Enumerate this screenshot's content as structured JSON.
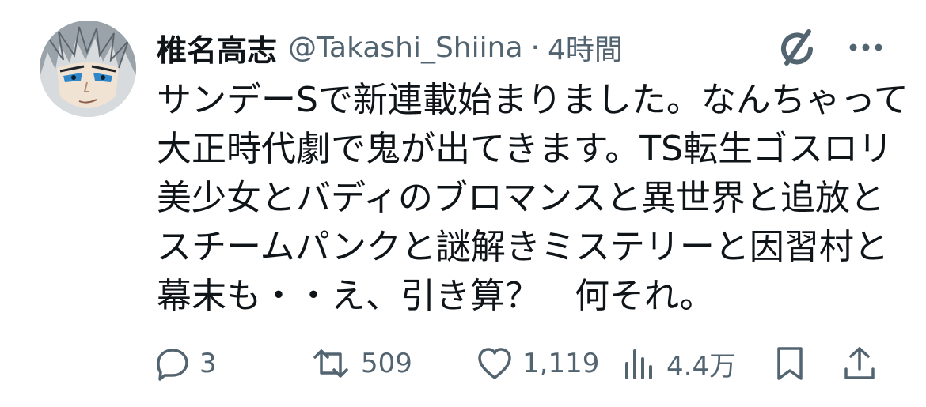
{
  "tweet": {
    "author": {
      "display_name": "椎名高志",
      "handle": "@Takashi_Shiina",
      "avatar_icon": "avatar-image"
    },
    "separator": "·",
    "timestamp": "4時間",
    "text_lines": [
      "サンデーSで新連載始まりました。なんちゃって",
      "大正時代劇で鬼が出てきます。TS転生ゴスロリ",
      "美少女とバディのブロマンスと異世界と追放と",
      "スチームパンクと謎解きミステリーと因習村と",
      "幕末も・・え、引き算？　何それ。"
    ],
    "header_icons": {
      "grok": "grok-icon",
      "more": "more-icon"
    },
    "actions": {
      "reply": {
        "icon": "reply-icon",
        "count": "3"
      },
      "repost": {
        "icon": "repost-icon",
        "count": "509"
      },
      "like": {
        "icon": "heart-icon",
        "count": "1,119"
      },
      "views": {
        "icon": "views-icon",
        "count": "4.4万"
      },
      "bookmark": {
        "icon": "bookmark-icon"
      },
      "share": {
        "icon": "share-icon"
      }
    },
    "colors": {
      "text_primary": "#0f1419",
      "text_secondary": "#536471",
      "background": "#ffffff"
    }
  }
}
